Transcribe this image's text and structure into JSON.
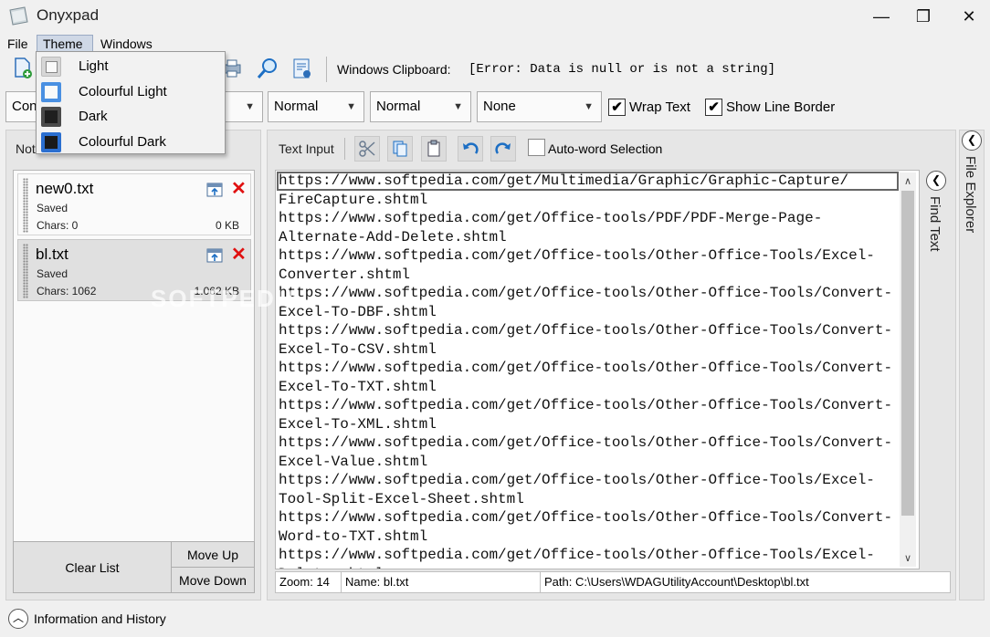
{
  "window": {
    "title": "Onyxpad",
    "minimize_glyph": "—",
    "maximize_glyph": "❐",
    "close_glyph": "✕"
  },
  "menu": {
    "file": "File",
    "theme": "Theme",
    "windows": "Windows"
  },
  "theme_menu": {
    "items": [
      {
        "label": "Light"
      },
      {
        "label": "Colourful Light"
      },
      {
        "label": "Dark"
      },
      {
        "label": "Colourful Dark"
      }
    ]
  },
  "toolbar": {
    "clipboard_label": "Windows Clipboard:",
    "clipboard_value": "[Error: Data is null or is not a string]"
  },
  "format_bar": {
    "font_combo": "Cons",
    "weight_combo": "Normal",
    "style_combo": "Normal",
    "decoration_combo": "None",
    "wrap_text_label": "Wrap Text",
    "wrap_text_checked": true,
    "show_line_border_label": "Show Line Border",
    "show_line_border_checked": true,
    "check_glyph": "✔"
  },
  "notes_panel": {
    "title": "Not",
    "notes": [
      {
        "name": "new0.txt",
        "status": "Saved",
        "chars": "Chars: 0",
        "size": "0 KB"
      },
      {
        "name": "bl.txt",
        "status": "Saved",
        "chars": "Chars: 1062",
        "size": "1.062 KB"
      }
    ],
    "clear_list": "Clear List",
    "move_up": "Move Up",
    "move_down": "Move Down"
  },
  "editor_panel": {
    "title": "Text Input",
    "auto_word_label": "Auto-word Selection",
    "text": "https://www.softpedia.com/get/Multimedia/Graphic/Graphic-Capture/\nFireCapture.shtml\nhttps://www.softpedia.com/get/Office-tools/PDF/PDF-Merge-Page-\nAlternate-Add-Delete.shtml\nhttps://www.softpedia.com/get/Office-tools/Other-Office-Tools/Excel-\nConverter.shtml\nhttps://www.softpedia.com/get/Office-tools/Other-Office-Tools/Convert-\nExcel-To-DBF.shtml\nhttps://www.softpedia.com/get/Office-tools/Other-Office-Tools/Convert-\nExcel-To-CSV.shtml\nhttps://www.softpedia.com/get/Office-tools/Other-Office-Tools/Convert-\nExcel-To-TXT.shtml\nhttps://www.softpedia.com/get/Office-tools/Other-Office-Tools/Convert-\nExcel-To-XML.shtml\nhttps://www.softpedia.com/get/Office-tools/Other-Office-Tools/Convert-\nExcel-Value.shtml\nhttps://www.softpedia.com/get/Office-tools/Other-Office-Tools/Excel-\nTool-Split-Excel-Sheet.shtml\nhttps://www.softpedia.com/get/Office-tools/Other-Office-Tools/Convert-\nWord-to-TXT.shtml\nhttps://www.softpedia.com/get/Office-tools/Other-Office-Tools/Excel-\nDelete-shtml",
    "status_zoom": "Zoom: 14",
    "status_name": "Name:  bl.txt",
    "status_path": "Path:  C:\\Users\\WDAGUtilityAccount\\Desktop\\bl.txt"
  },
  "side_panels": {
    "find_text": "Find Text",
    "file_explorer": "File Explorer"
  },
  "bottom": {
    "info_history": "Information and History"
  },
  "watermark": "SOFTPEDIA",
  "colors": {
    "accent_blue": "#1f6fd0",
    "close_red": "#e01010"
  }
}
